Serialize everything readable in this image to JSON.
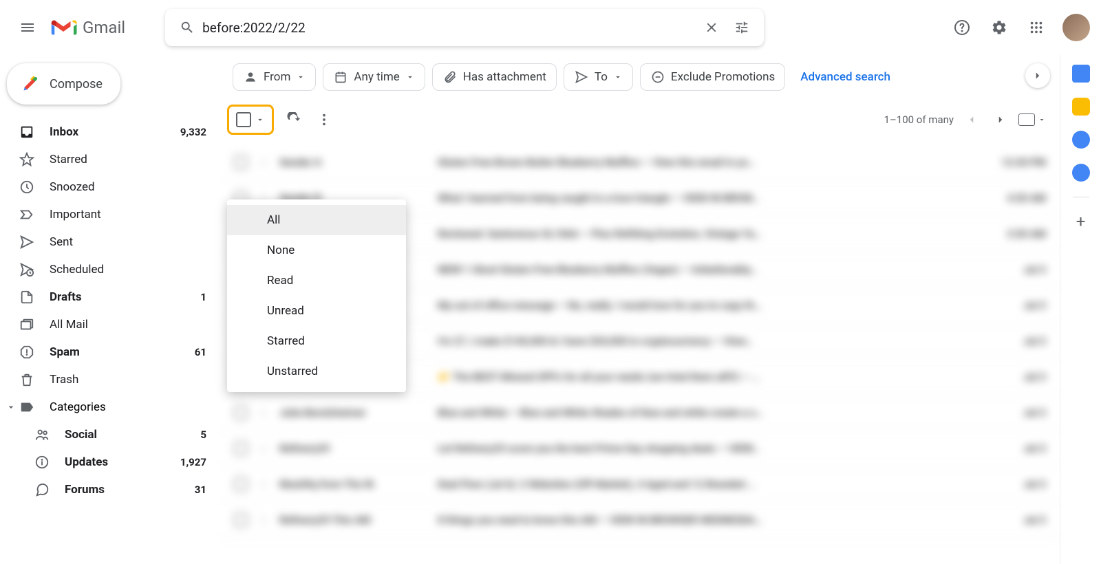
{
  "header": {
    "logo_text": "Gmail",
    "search_value": "before:2022/2/22"
  },
  "sidebar": {
    "compose_label": "Compose",
    "items": [
      {
        "label": "Inbox",
        "count": "9,332",
        "icon": "inbox"
      },
      {
        "label": "Starred",
        "count": "",
        "icon": "star"
      },
      {
        "label": "Snoozed",
        "count": "",
        "icon": "clock"
      },
      {
        "label": "Important",
        "count": "",
        "icon": "important"
      },
      {
        "label": "Sent",
        "count": "",
        "icon": "send"
      },
      {
        "label": "Scheduled",
        "count": "",
        "icon": "schedule"
      },
      {
        "label": "Drafts",
        "count": "1",
        "icon": "draft"
      },
      {
        "label": "All Mail",
        "count": "",
        "icon": "allmail"
      },
      {
        "label": "Spam",
        "count": "61",
        "icon": "spam"
      },
      {
        "label": "Trash",
        "count": "",
        "icon": "trash"
      }
    ],
    "categories_label": "Categories",
    "sub_items": [
      {
        "label": "Social",
        "count": "5"
      },
      {
        "label": "Updates",
        "count": "1,927"
      },
      {
        "label": "Forums",
        "count": "31"
      }
    ]
  },
  "filters": {
    "from": "From",
    "any_time": "Any time",
    "has_attachment": "Has attachment",
    "to": "To",
    "exclude_promotions": "Exclude Promotions",
    "advanced": "Advanced search"
  },
  "toolbar": {
    "pagination_text": "1–100 of many"
  },
  "dropdown": {
    "items": [
      "All",
      "None",
      "Read",
      "Unread",
      "Starred",
      "Unstarred"
    ]
  },
  "mail_rows": [
    {
      "sender": "Sender A",
      "subject": "Gluten-Free Brown Butter Blueberry Muffins — View this email in yo…",
      "time": "12:30 PM"
    },
    {
      "sender": "Sender B",
      "subject": "What I learned from being caught in a love triangle — VIEW IN BROW…",
      "time": "4:30 AM"
    },
    {
      "sender": "Sender C",
      "subject": "Reviewed: Sanlorenzo SL106A — Plus Refitting Evolution, Vintage Ya…",
      "time": "3:30 AM"
    },
    {
      "sender": "Sender D",
      "subject": "NEW! 1-Bowl Gluten-Free Blueberry Muffins (Vegan) — Unbelievably…",
      "time": "Jul 3"
    },
    {
      "sender": "Sender E",
      "subject": "My out of office message — No, really. I would love for you to copy th…",
      "time": "Jul 3"
    },
    {
      "sender": "Sender F",
      "subject": "I'm 27, I make $140,000 & I have $20,000 in cryptocurrency — View…",
      "time": "Jul 3"
    },
    {
      "sender": "Sender G",
      "subject": "👉 The BEST Mineral SPFs for all your needs (we tried them all!!!) — …",
      "time": "Jul 3"
    },
    {
      "sender": "Julia Berolzheimer",
      "subject": "Blue and White — Blue and White Shades of blue and white create a s…",
      "time": "Jul 3"
    },
    {
      "sender": "Refinery29",
      "subject": "Let Refinery29 score you the best Prime Day shopping deals — VIEW…",
      "time": "Jul 3"
    },
    {
      "sender": "Mushfiq from The W.",
      "subject": "Deal Flow (Jul 6): 2 Websites (Off-Market), 4 Aged and 12 Branded …",
      "time": "Jul 3"
    },
    {
      "sender": "Refinery29 This AM",
      "subject": "8 things you need to know this AM — VIEW IN BROWSER WEDNESDA…",
      "time": "Jul 3"
    }
  ]
}
